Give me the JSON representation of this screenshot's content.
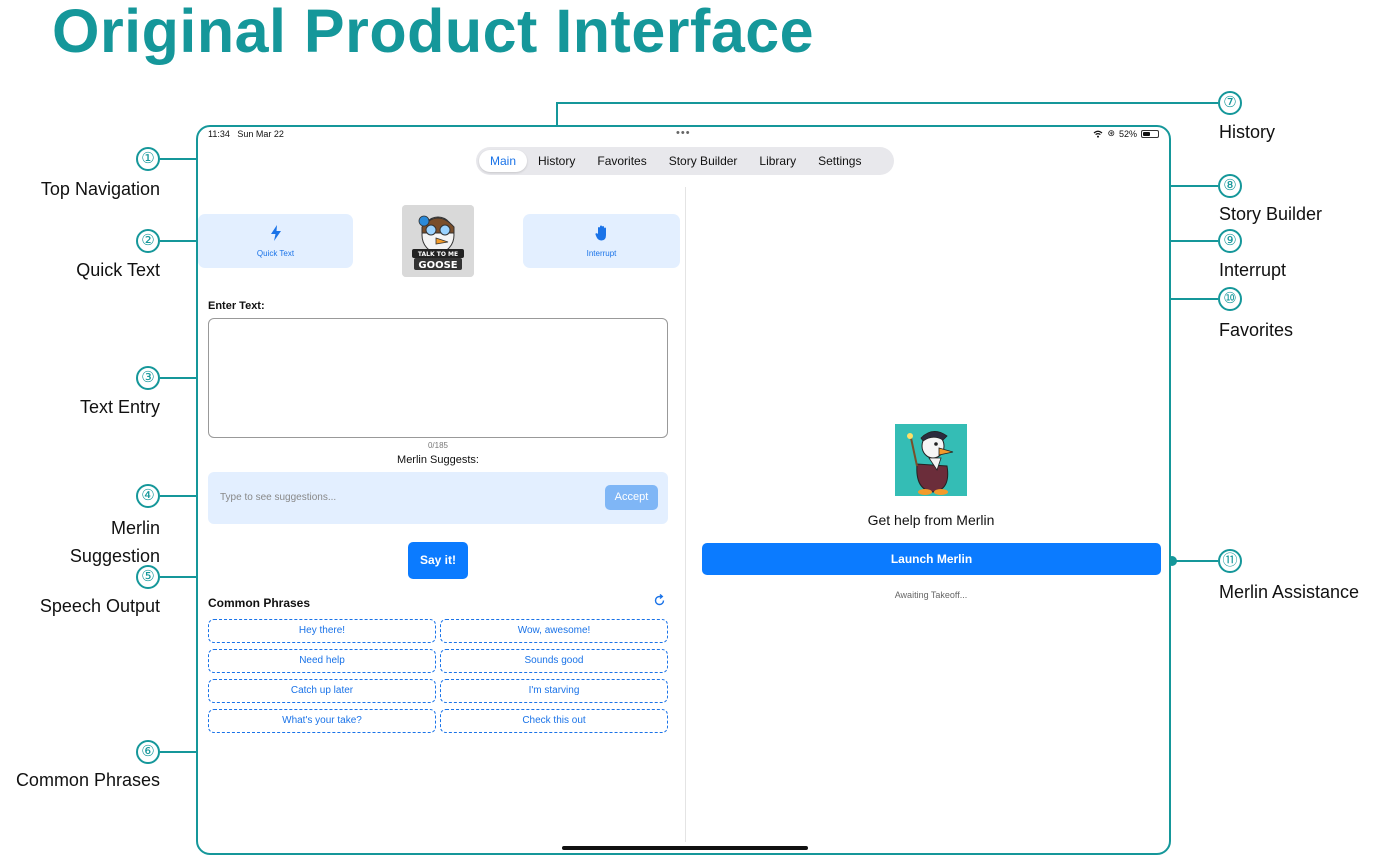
{
  "title": "Original Product Interface",
  "status_bar": {
    "time": "11:34",
    "date": "Sun Mar 22",
    "dots": "•••",
    "battery": "52%",
    "battery_level": 0.52
  },
  "nav_tabs": [
    "Main",
    "History",
    "Favorites",
    "Story Builder",
    "Library",
    "Settings"
  ],
  "active_tab": "Main",
  "left_panel": {
    "quick_text_label": "Quick Text",
    "interrupt_label": "Interrupt",
    "logo_text_line1": "TALK TO ME",
    "logo_text_line2": "GOOSE",
    "enter_text_label": "Enter Text:",
    "char_count": "0/185",
    "suggests_title": "Merlin Suggests:",
    "suggestion_placeholder": "Type to see suggestions...",
    "accept_label": "Accept",
    "say_it_label": "Say it!",
    "common_phrases_title": "Common Phrases",
    "phrases": [
      "Hey there!",
      "Wow, awesome!",
      "Need help",
      "Sounds good",
      "Catch up later",
      "I'm starving",
      "What's your take?",
      "Check this out"
    ]
  },
  "right_panel": {
    "help_text": "Get help from Merlin",
    "launch_label": "Launch Merlin",
    "status_text": "Awaiting Takeoff..."
  },
  "callouts": [
    {
      "num": "①",
      "label": "Top Navigation"
    },
    {
      "num": "②",
      "label": "Quick Text"
    },
    {
      "num": "③",
      "label": "Text Entry"
    },
    {
      "num": "④",
      "label": "Merlin\nSuggestion"
    },
    {
      "num": "⑤",
      "label": "Speech Output"
    },
    {
      "num": "⑥",
      "label": "Common Phrases"
    },
    {
      "num": "⑦",
      "label": "History"
    },
    {
      "num": "⑧",
      "label": "Story Builder"
    },
    {
      "num": "⑨",
      "label": "Interrupt"
    },
    {
      "num": "⑩",
      "label": "Favorites"
    },
    {
      "num": "⑪",
      "label": "Merlin Assistance"
    }
  ],
  "colors": {
    "accent": "#15979a",
    "primary_blue": "#0b7bff",
    "card_bg": "#e3efff"
  }
}
